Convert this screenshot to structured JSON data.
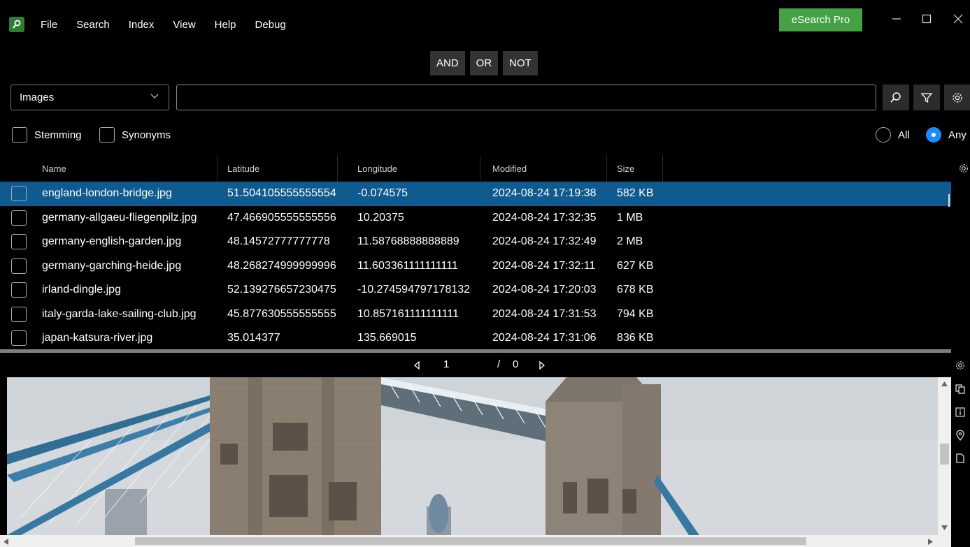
{
  "menu": {
    "items": [
      "File",
      "Search",
      "Index",
      "View",
      "Help",
      "Debug"
    ],
    "pro_button": "eSearch Pro"
  },
  "operators": [
    "AND",
    "OR",
    "NOT"
  ],
  "search": {
    "category": "Images",
    "query": "",
    "placeholder": ""
  },
  "options": {
    "stemming": "Stemming",
    "synonyms": "Synonyms",
    "all": "All",
    "any": "Any",
    "selected_mode": "Any"
  },
  "table": {
    "columns": [
      "Name",
      "Latitude",
      "Longitude",
      "Modified",
      "Size"
    ],
    "rows": [
      [
        "england-london-bridge.jpg",
        "51.504105555555554",
        "-0.074575",
        "2024-08-24 17:19:38",
        "582 KB"
      ],
      [
        "germany-allgaeu-fliegenpilz.jpg",
        "47.466905555555556",
        "10.20375",
        "2024-08-24 17:32:35",
        "1 MB"
      ],
      [
        "germany-english-garden.jpg",
        "48.14572777777778",
        "11.58768888888889",
        "2024-08-24 17:32:49",
        "2 MB"
      ],
      [
        "germany-garching-heide.jpg",
        "48.268274999999996",
        "11.603361111111111",
        "2024-08-24 17:32:11",
        "627 KB"
      ],
      [
        "irland-dingle.jpg",
        "52.139276657230475",
        "-10.274594797178132",
        "2024-08-24 17:20:03",
        "678 KB"
      ],
      [
        "italy-garda-lake-sailing-club.jpg",
        "45.877630555555555",
        "10.857161111111111",
        "2024-08-24 17:31:53",
        "794 KB"
      ],
      [
        "japan-katsura-river.jpg",
        "35.014377",
        "135.669015",
        "2024-08-24 17:31:06",
        "836 KB"
      ]
    ],
    "selected_row": 0
  },
  "pager": {
    "current": "1",
    "separator": "/",
    "total": "0"
  },
  "colors": {
    "accent": "#44a144",
    "selection": "#0f5a8e",
    "radio_on": "#1a8cff"
  }
}
